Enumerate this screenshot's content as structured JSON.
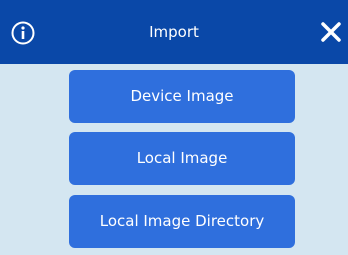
{
  "dialog": {
    "title": "Import",
    "info_icon": "info-icon",
    "close_icon": "close-icon",
    "buttons": [
      {
        "label": "Device Image"
      },
      {
        "label": "Local Image"
      },
      {
        "label": "Local Image Directory"
      }
    ]
  },
  "colors": {
    "titlebar": "#0a48a8",
    "body": "#d4e6f1",
    "button": "#2f6fdd",
    "text_light": "#ffffff"
  }
}
